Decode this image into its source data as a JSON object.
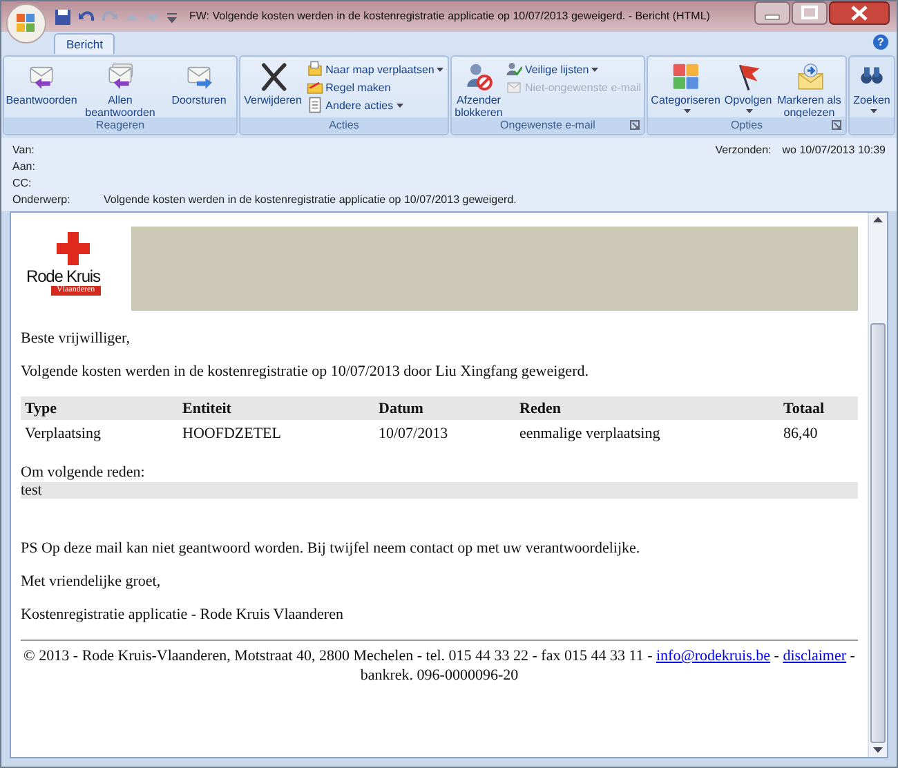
{
  "window": {
    "title": "FW: Volgende kosten werden in de kostenregistratie applicatie op 10/07/2013 geweigerd. - Bericht (HTML)"
  },
  "tabs": [
    {
      "label": "Bericht",
      "selected": true
    }
  ],
  "help_button": "?",
  "ribbon": {
    "groups": [
      {
        "label": "Reageren",
        "launcher": false,
        "buttons": [
          {
            "kind": "large",
            "label": "Beantwoorden",
            "dropdown": false
          },
          {
            "kind": "large",
            "label": "Allen beantwoorden",
            "dropdown": false
          },
          {
            "kind": "large",
            "label": "Doorsturen",
            "dropdown": false
          }
        ]
      },
      {
        "label": "Acties",
        "launcher": false,
        "buttons": [
          {
            "kind": "large",
            "label": "Verwijderen",
            "dropdown": false
          },
          {
            "kind": "stack",
            "items": [
              {
                "label": "Naar map verplaatsen",
                "dropdown": true,
                "disabled": false
              },
              {
                "label": "Regel maken",
                "dropdown": false,
                "disabled": false
              },
              {
                "label": "Andere acties",
                "dropdown": true,
                "disabled": false
              }
            ]
          }
        ]
      },
      {
        "label": "Ongewenste e-mail",
        "launcher": true,
        "buttons": [
          {
            "kind": "large",
            "label": "Afzender blokkeren",
            "dropdown": false
          },
          {
            "kind": "stack",
            "items": [
              {
                "label": "Veilige lijsten",
                "dropdown": true,
                "disabled": false
              },
              {
                "label": "Niet-ongewenste e-mail",
                "dropdown": false,
                "disabled": true
              }
            ]
          }
        ]
      },
      {
        "label": "Opties",
        "launcher": true,
        "buttons": [
          {
            "kind": "large",
            "label": "Categoriseren",
            "dropdown": true
          },
          {
            "kind": "large",
            "label": "Opvolgen",
            "dropdown": true
          },
          {
            "kind": "large",
            "label": "Markeren als ongelezen",
            "dropdown": false
          }
        ]
      },
      {
        "launcher": false,
        "buttons": [
          {
            "kind": "large",
            "label": "Zoeken",
            "dropdown": true
          }
        ]
      }
    ]
  },
  "header": {
    "fields": [
      {
        "label": "Van:"
      },
      {
        "label": "Aan:"
      },
      {
        "label": "CC:"
      },
      {
        "label": "Onderwerp:",
        "value": "Volgende kosten werden in de kostenregistratie applicatie op 10/07/2013 geweigerd."
      }
    ],
    "sent": {
      "label": "Verzonden:",
      "value": "wo 10/07/2013 10:39"
    }
  },
  "message": {
    "logo": {
      "name": "Rode Kruis",
      "region": "Vlaanderen"
    },
    "greeting": "Beste vrijwilliger,",
    "intro": "Volgende kosten werden in de kostenregistratie op 10/07/2013 door Liu Xingfang geweigerd.",
    "table": {
      "columns": [
        "Type",
        "Entiteit",
        "Datum",
        "Reden",
        "Totaal"
      ],
      "rows": [
        [
          "Verplaatsing",
          "HOOFDZETEL",
          "10/07/2013",
          "eenmalige verplaatsing",
          "86,40"
        ]
      ]
    },
    "reason_label": "Om volgende reden:",
    "reason": "test",
    "ps": "PS Op deze mail kan niet geantwoord worden. Bij twijfel neem contact op met uw verantwoordelijke.",
    "closing": "Met vriendelijke groet,",
    "signature": "Kostenregistratie applicatie - Rode Kruis Vlaanderen",
    "footer": {
      "text": "© 2013 - Rode Kruis-Vlaanderen, Motstraat 40, 2800 Mechelen - tel. 015 44 33 22 - fax 015 44 33 11 -",
      "email": "info@rodekruis.be",
      "separator": "-",
      "disclaimer": "disclaimer",
      "after": "- bankrek. 096-0000096-20"
    }
  }
}
